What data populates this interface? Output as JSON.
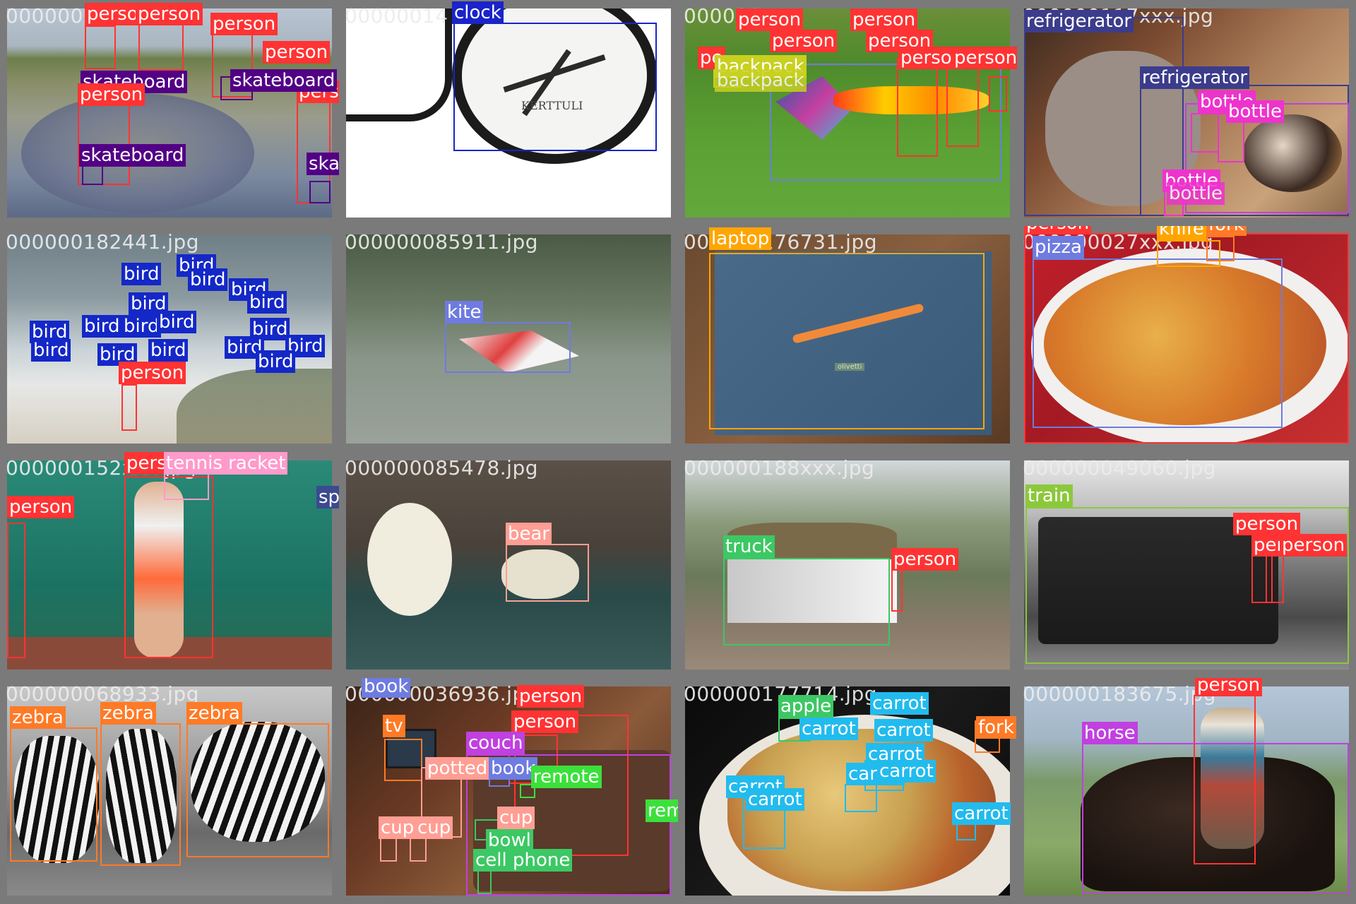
{
  "title": "",
  "tiles": [
    {
      "filename": "000000",
      "labels": [
        {
          "text": "person",
          "color": "#ff3333"
        },
        {
          "text": "person",
          "color": "#ff3333"
        },
        {
          "text": "person",
          "color": "#ff3333"
        },
        {
          "text": "person",
          "color": "#ff3333"
        },
        {
          "text": "person",
          "color": "#ff3333"
        },
        {
          "text": "skateboard",
          "color": "#520085"
        },
        {
          "text": "skateboard",
          "color": "#520085"
        },
        {
          "text": "person",
          "color": "#ff3333"
        },
        {
          "text": "skateboard",
          "color": "#520085"
        },
        {
          "text": "skateboard",
          "color": "#520085"
        }
      ]
    },
    {
      "filename": "00000014",
      "labels": [
        {
          "text": "clock",
          "color": "#1a24c8"
        }
      ],
      "scene_text": "KERTTULI"
    },
    {
      "filename": "000000",
      "labels": [
        {
          "text": "person",
          "color": "#ff3333"
        },
        {
          "text": "person",
          "color": "#ff3333"
        },
        {
          "text": "person",
          "color": "#ff3333"
        },
        {
          "text": "person",
          "color": "#ff3333"
        },
        {
          "text": "person",
          "color": "#ff3333"
        },
        {
          "text": "pe",
          "color": "#ff3333"
        },
        {
          "text": "backpack",
          "color": "#c8d020"
        },
        {
          "text": "backpack",
          "color": "#c8d020"
        },
        {
          "text": "person",
          "color": "#ff3333"
        },
        {
          "text": "person",
          "color": "#ff3333"
        }
      ]
    },
    {
      "filename": "000000117xxx.jpg",
      "labels": [
        {
          "text": "refrigerator",
          "color": "#3c3c8c"
        },
        {
          "text": "refrigerator",
          "color": "#3c3c8c"
        },
        {
          "text": "bottle",
          "color": "#ee33cc"
        },
        {
          "text": "bottle",
          "color": "#ee33cc"
        },
        {
          "text": "bottle",
          "color": "#ee33cc"
        },
        {
          "text": "bottle",
          "color": "#ee33cc"
        }
      ]
    },
    {
      "filename": "000000182441.jpg",
      "labels": [
        {
          "text": "bird",
          "color": "#1428c8"
        },
        {
          "text": "bird",
          "color": "#1428c8"
        },
        {
          "text": "bird",
          "color": "#1428c8"
        },
        {
          "text": "bird",
          "color": "#1428c8"
        },
        {
          "text": "bird",
          "color": "#1428c8"
        },
        {
          "text": "bird",
          "color": "#1428c8"
        },
        {
          "text": "bird",
          "color": "#1428c8"
        },
        {
          "text": "bird",
          "color": "#1428c8"
        },
        {
          "text": "bird",
          "color": "#1428c8"
        },
        {
          "text": "bird",
          "color": "#1428c8"
        },
        {
          "text": "bird",
          "color": "#1428c8"
        },
        {
          "text": "bird",
          "color": "#1428c8"
        },
        {
          "text": "bird",
          "color": "#1428c8"
        },
        {
          "text": "bird",
          "color": "#1428c8"
        },
        {
          "text": "bird",
          "color": "#1428c8"
        },
        {
          "text": "bird",
          "color": "#1428c8"
        },
        {
          "text": "bird",
          "color": "#1428c8"
        },
        {
          "text": "person",
          "color": "#ff3333"
        }
      ]
    },
    {
      "filename": "000000085911.jpg",
      "labels": [
        {
          "text": "kite",
          "color": "#6e7be0"
        }
      ]
    },
    {
      "filename": "000000176731.jpg",
      "labels": [
        {
          "text": "laptop",
          "color": "#ffa500"
        }
      ],
      "scene_text": "olivetti"
    },
    {
      "filename": "000000027xxx.jpg",
      "labels": [
        {
          "text": "person",
          "color": "#ff3333"
        },
        {
          "text": "pizza",
          "color": "#6e7be0"
        },
        {
          "text": "knife",
          "color": "#ffa500"
        },
        {
          "text": "fork",
          "color": "#ff7a26"
        }
      ]
    },
    {
      "filename": "000000152xxx.jpg",
      "labels": [
        {
          "text": "person",
          "color": "#ff3333"
        },
        {
          "text": "tennis racket",
          "color": "#ff9acb"
        },
        {
          "text": "person",
          "color": "#ff3333"
        },
        {
          "text": "sports ball",
          "color": "#3c4a90"
        }
      ]
    },
    {
      "filename": "000000085478.jpg",
      "labels": [
        {
          "text": "bear",
          "color": "#ff9e94"
        }
      ]
    },
    {
      "filename": "000000188xxx.jpg",
      "labels": [
        {
          "text": "truck",
          "color": "#3cc864"
        },
        {
          "text": "person",
          "color": "#ff3333"
        }
      ]
    },
    {
      "filename": "000000049060.jpg",
      "labels": [
        {
          "text": "train",
          "color": "#8cc83c"
        },
        {
          "text": "person",
          "color": "#ff3333"
        },
        {
          "text": "person",
          "color": "#ff3333"
        },
        {
          "text": "person",
          "color": "#ff3333"
        }
      ]
    },
    {
      "filename": "000000068933.jpg",
      "labels": [
        {
          "text": "zebra",
          "color": "#ff7a26"
        },
        {
          "text": "zebra",
          "color": "#ff7a26"
        },
        {
          "text": "zebra",
          "color": "#ff7a26"
        }
      ]
    },
    {
      "filename": "000000036936.jpg",
      "labels": [
        {
          "text": "book",
          "color": "#6e7be0"
        },
        {
          "text": "person",
          "color": "#ff3333"
        },
        {
          "text": "person",
          "color": "#ff3333"
        },
        {
          "text": "tv",
          "color": "#ff7a26"
        },
        {
          "text": "couch",
          "color": "#c040e0"
        },
        {
          "text": "potted",
          "color": "#ff9e94"
        },
        {
          "text": "book",
          "color": "#6e7be0"
        },
        {
          "text": "remote",
          "color": "#3ce03c"
        },
        {
          "text": "remote",
          "color": "#3ce03c"
        },
        {
          "text": "cup",
          "color": "#ff9e94"
        },
        {
          "text": "cup",
          "color": "#ff9e94"
        },
        {
          "text": "cup",
          "color": "#ff9e94"
        },
        {
          "text": "bowl",
          "color": "#3cc864"
        },
        {
          "text": "cell phone",
          "color": "#3cc864"
        }
      ]
    },
    {
      "filename": "000000177714.jpg",
      "labels": [
        {
          "text": "apple",
          "color": "#3cc864"
        },
        {
          "text": "carrot",
          "color": "#22bbee"
        },
        {
          "text": "carrot",
          "color": "#22bbee"
        },
        {
          "text": "carrot",
          "color": "#22bbee"
        },
        {
          "text": "fork",
          "color": "#ff7a26"
        },
        {
          "text": "carrot",
          "color": "#22bbee"
        },
        {
          "text": "carrot",
          "color": "#22bbee"
        },
        {
          "text": "carrot",
          "color": "#22bbee"
        },
        {
          "text": "carrot",
          "color": "#22bbee"
        },
        {
          "text": "carrot",
          "color": "#22bbee"
        },
        {
          "text": "carrot",
          "color": "#22bbee"
        }
      ]
    },
    {
      "filename": "000000183675.jpg",
      "labels": [
        {
          "text": "person",
          "color": "#ff3333"
        },
        {
          "text": "horse",
          "color": "#c040e0"
        }
      ]
    }
  ]
}
